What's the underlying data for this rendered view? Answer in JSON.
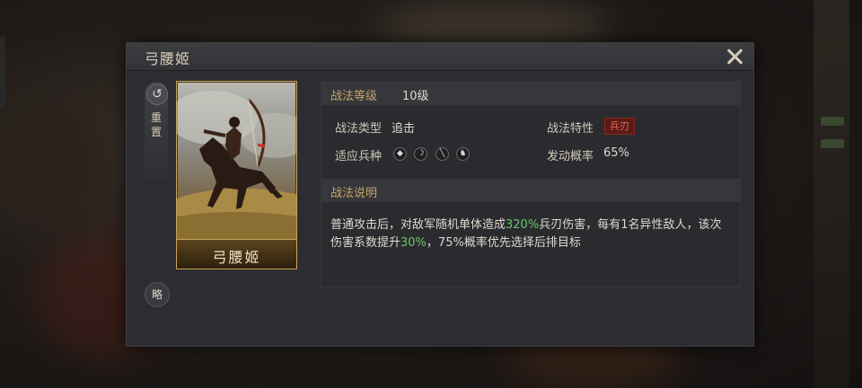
{
  "dialog": {
    "title": "弓腰姬",
    "reset_label": "重置",
    "brief_label": "略"
  },
  "portrait": {
    "name": "弓腰姬"
  },
  "skill": {
    "level_label": "战法等级",
    "level_value": "10级",
    "type_label": "战法类型",
    "type_value": "追击",
    "trait_label": "战法特性",
    "trait_value": "兵刃",
    "troops_label": "适应兵种",
    "troop_icons": [
      "shield-icon",
      "bow-icon",
      "spear-icon",
      "horse-icon"
    ],
    "chance_label": "发动概率",
    "chance_value": "65%",
    "desc_label": "战法说明",
    "desc": {
      "p1": "普通攻击后，对敌军随机单体造成",
      "h1": "320%",
      "p2": "兵刃伤害，每有1名异性敌人，该次伤害系数提升",
      "h2": "30%",
      "p3": "，75%概率优先选择后排目标"
    }
  },
  "colors": {
    "highlight": "#6cc46c",
    "gold_label": "#c4a46a",
    "trait_badge": "#5a1a16"
  }
}
